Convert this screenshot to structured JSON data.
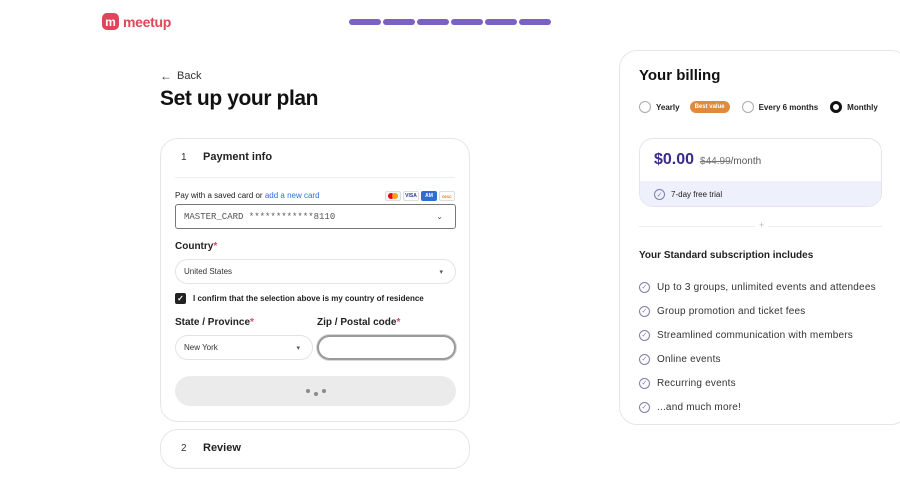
{
  "brand": {
    "badge": "m",
    "name": "meetup",
    "color": "#e0455b"
  },
  "progress": {
    "total_steps": 6,
    "completed_steps": 6,
    "color": "#7b61c4"
  },
  "nav": {
    "back_label": "Back"
  },
  "page": {
    "title": "Set up your plan"
  },
  "payment": {
    "step_number": "1",
    "step_label": "Payment info",
    "saved_card_text": "Pay with a saved card or",
    "add_card_link": "add a new card",
    "card_logos": [
      "mastercard-icon",
      "visa-icon",
      "amex-icon",
      "discover-icon"
    ],
    "saved_card_value": "MASTER_CARD ************8110",
    "country_label": "Country",
    "country_value": "United States",
    "confirm_text": "I confirm that the selection above is my country of residence",
    "confirm_checked": true,
    "state_label": "State / Province",
    "state_value": "New York",
    "zip_label": "Zip / Postal code",
    "zip_value": "",
    "required_mark": "*"
  },
  "review": {
    "step_number": "2",
    "step_label": "Review"
  },
  "billing": {
    "title": "Your billing",
    "options": [
      {
        "label": "Yearly",
        "selected": false,
        "badge": "Best value"
      },
      {
        "label": "Every 6 months",
        "selected": false
      },
      {
        "label": "Monthly",
        "selected": true
      }
    ],
    "price": "$0.00",
    "old_price": "$44.99",
    "per": "/month",
    "trial": "7-day free trial",
    "includes_title": "Your Standard subscription includes",
    "features": [
      "Up to 3 groups, unlimited events and attendees",
      "Group promotion and ticket fees",
      "Streamlined communication with members",
      "Online events",
      "Recurring events",
      "...and much more!"
    ]
  }
}
